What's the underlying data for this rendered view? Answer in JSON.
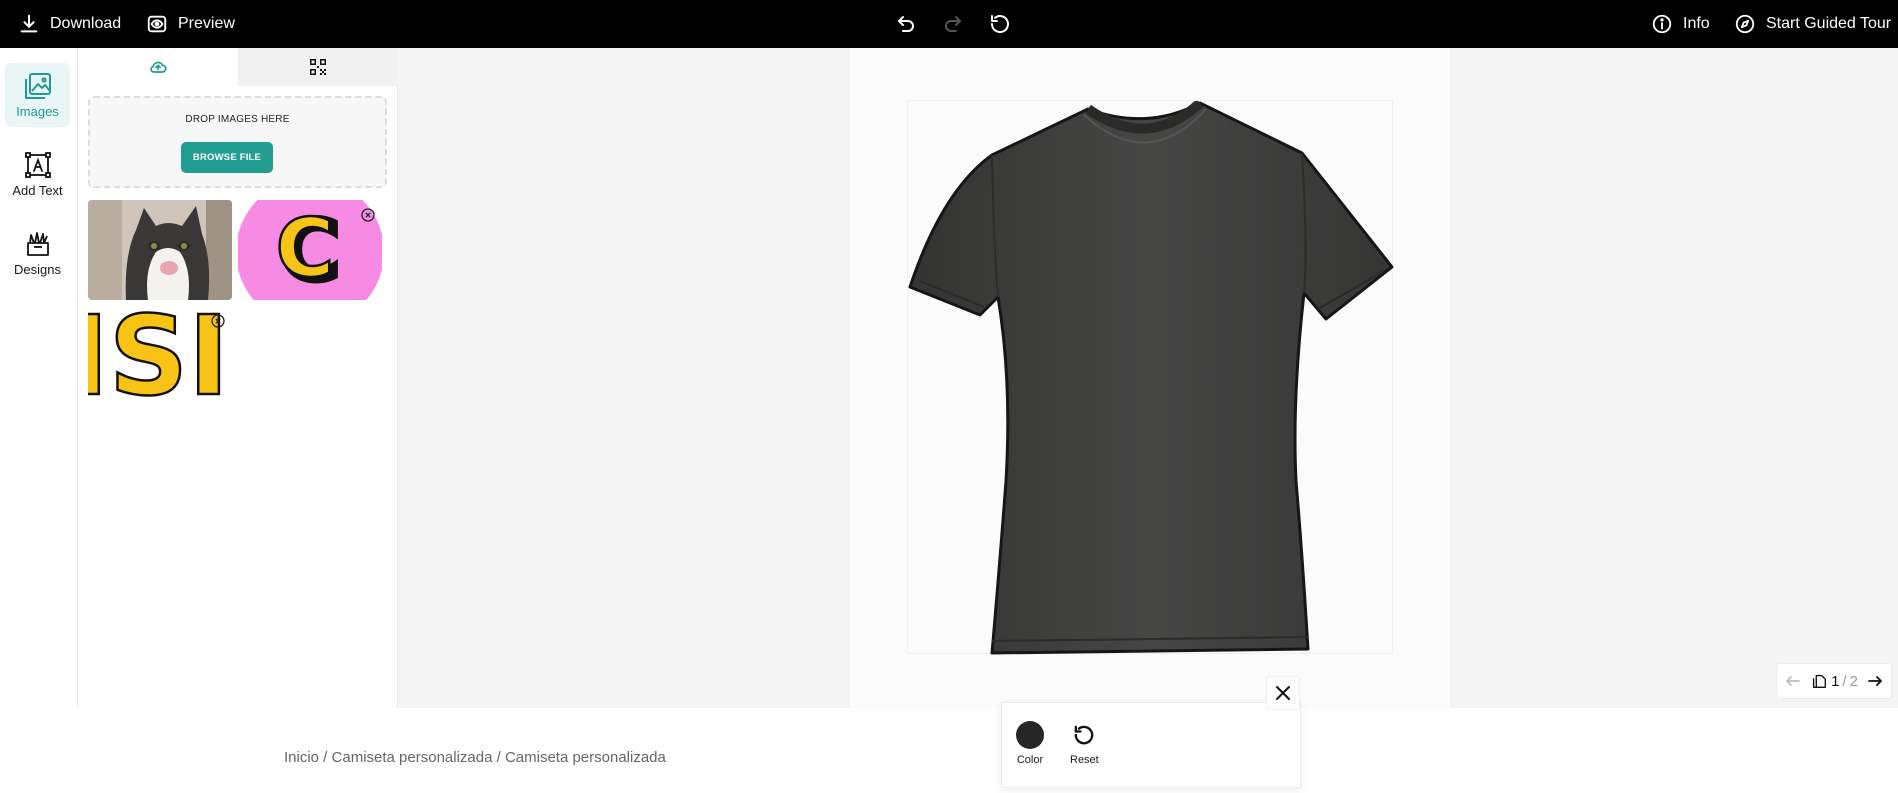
{
  "topbar": {
    "download_label": "Download",
    "preview_label": "Preview",
    "info_label": "Info",
    "tour_label": "Start Guided Tour"
  },
  "rail": {
    "items": [
      {
        "label": "Images",
        "icon": "images-icon",
        "active": true
      },
      {
        "label": "Add Text",
        "icon": "add-text-icon",
        "active": false
      },
      {
        "label": "Designs",
        "icon": "designs-icon",
        "active": false
      }
    ]
  },
  "panel": {
    "tabs": [
      {
        "icon": "cloud-upload-icon",
        "active": true
      },
      {
        "icon": "qr-code-icon",
        "active": false
      }
    ],
    "drop_text": "DROP IMAGES HERE",
    "browse_label": "BROWSE FILE",
    "thumb_letter_c": "C",
    "thumb_letters_si": "ISI"
  },
  "pager": {
    "current": "1",
    "separator": "/",
    "total": "2"
  },
  "popup": {
    "color_label": "Color",
    "reset_label": "Reset"
  },
  "breadcrumb": "Inicio / Camiseta personalizada / Camiseta personalizada",
  "colors": {
    "accent": "#219d92",
    "accent_light": "#e9f6f5",
    "shirt": "#3f3f3e",
    "topbar": "#000000"
  }
}
